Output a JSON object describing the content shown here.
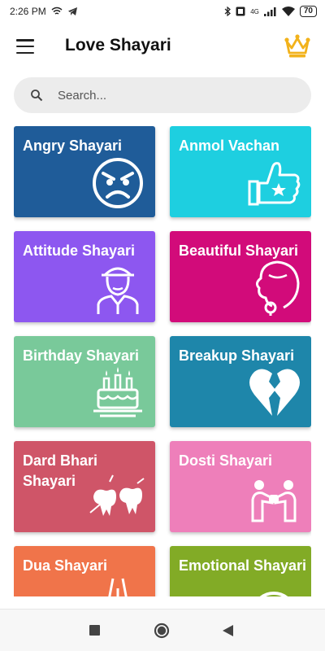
{
  "status_bar": {
    "time": "2:26 PM",
    "battery": "70",
    "network": "4G"
  },
  "app_bar": {
    "title": "Love Shayari",
    "menu_icon": "hamburger-menu-icon",
    "premium_icon": "crown-icon",
    "accent": "#f2b21b"
  },
  "search": {
    "placeholder": "Search..."
  },
  "categories": [
    {
      "label": "Angry Shayari",
      "color": "#1f5c99",
      "icon": "angry-face-icon"
    },
    {
      "label": "Anmol Vachan",
      "color": "#1ecfe0",
      "icon": "thumbs-up-icon"
    },
    {
      "label": "Attitude Shayari",
      "color": "#8d57f0",
      "icon": "man-in-cap-icon"
    },
    {
      "label": "Beautiful Shayari",
      "color": "#d20b7a",
      "icon": "woman-face-icon"
    },
    {
      "label": "Birthday Shayari",
      "color": "#79c99a",
      "icon": "birthday-cake-icon"
    },
    {
      "label": "Breakup Shayari",
      "color": "#1e86aa",
      "icon": "broken-heart-icon"
    },
    {
      "label": "Dard Bhari Shayari",
      "color": "#cf5568",
      "icon": "broken-teeth-icon"
    },
    {
      "label": "Dosti Shayari",
      "color": "#ee7fba",
      "icon": "friends-hands-icon"
    },
    {
      "label": "Dua Shayari",
      "color": "#f0744a",
      "icon": "praying-hands-icon"
    },
    {
      "label": "Emotional Shayari",
      "color": "#82ab26",
      "icon": "emotional-face-icon"
    }
  ],
  "nav_bar": {
    "recent_icon": "square-recents-icon",
    "home_icon": "circle-home-icon",
    "back_icon": "triangle-back-icon"
  }
}
